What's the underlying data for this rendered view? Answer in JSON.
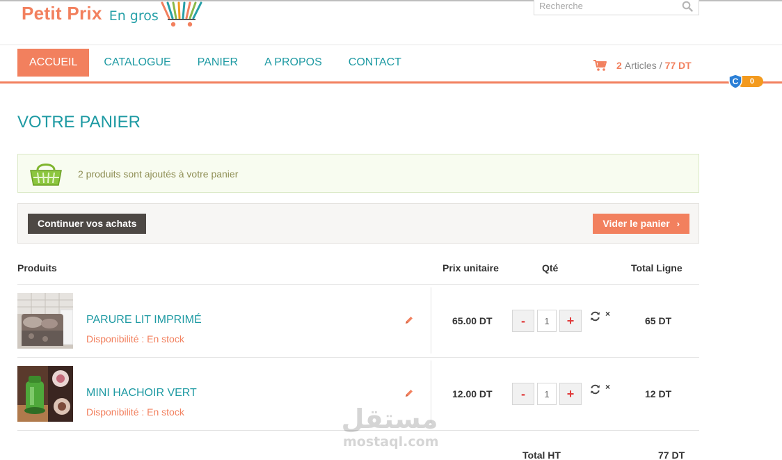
{
  "brand": {
    "name_primary": "Petit Prix",
    "name_secondary": "En gros",
    "color_primary": "#f2805e",
    "color_secondary": "#1e9aa3"
  },
  "search": {
    "placeholder": "Recherche",
    "icon": "search-icon"
  },
  "nav": {
    "items": [
      {
        "label": "ACCUEIL",
        "active": true
      },
      {
        "label": "CATALOGUE",
        "active": false
      },
      {
        "label": "PANIER",
        "active": false
      },
      {
        "label": "A PROPOS",
        "active": false
      },
      {
        "label": "CONTACT",
        "active": false
      }
    ]
  },
  "cart_summary": {
    "icon": "cart-icon",
    "count": "2",
    "word": "Articles",
    "separator": "/",
    "total": "77 DT"
  },
  "badge": {
    "icon": "shield-icon",
    "letter": "C",
    "count": "0",
    "color": "#f39a1e"
  },
  "page": {
    "title": "VOTRE PANIER"
  },
  "notice": {
    "icon": "basket-icon",
    "text": "2 produits sont ajoutés à votre panier"
  },
  "actions": {
    "continue_label": "Continuer vos achats",
    "empty_label": "Vider le panier",
    "empty_chevron": "›"
  },
  "table": {
    "headers": {
      "product": "Produits",
      "unit_price": "Prix unitaire",
      "qty": "Qté",
      "line_total": "Total Ligne"
    },
    "rows": [
      {
        "name": "PARURE LIT IMPRIMÉ",
        "availability": "Disponibilité : En stock",
        "unit_price": "65.00 DT",
        "qty": "1",
        "minus": "-",
        "plus": "+",
        "remove": "×",
        "line_total": "65 DT"
      },
      {
        "name": "MINI HACHOIR VERT",
        "availability": "Disponibilité : En stock",
        "unit_price": "12.00 DT",
        "qty": "1",
        "minus": "-",
        "plus": "+",
        "remove": "×",
        "line_total": "12 DT"
      }
    ],
    "total_label": "Total HT",
    "total_value": "77 DT"
  },
  "watermark": {
    "arabic": "مستقل",
    "latin": "mostaql.com"
  }
}
